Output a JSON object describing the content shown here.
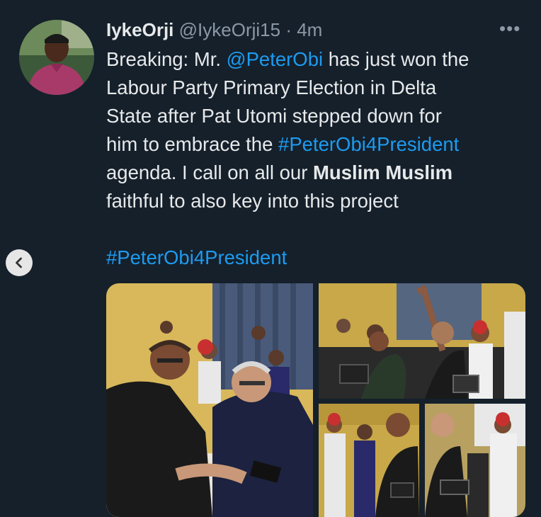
{
  "tweet": {
    "author_name": "IykeOrji",
    "author_handle": "@IykeOrji15",
    "separator": "·",
    "time": "4m",
    "more": "•••",
    "text_segments": {
      "l1_a": "Breaking: Mr. ",
      "l1_mention": "@PeterObi",
      "l1_b": " has just won the",
      "l2": "Labour Party Primary Election in Delta",
      "l3": "State after Pat Utomi stepped down for",
      "l4_a": "him to embrace the ",
      "l4_hashtag": "#PeterObi4President",
      "l5_a": "agenda. I call on all our ",
      "l5_bold": "Muslim Muslim",
      "l6": "faithful to also key into this project"
    },
    "hashtag": "#PeterObi4President"
  },
  "colors": {
    "background": "#15202b",
    "link": "#1d9bf0",
    "text": "#e7e9ea",
    "muted": "#8b98a5"
  },
  "icons": {
    "back": "chevron-left-icon",
    "more": "more-horizontal-icon"
  },
  "media": {
    "photo_count": 4
  }
}
